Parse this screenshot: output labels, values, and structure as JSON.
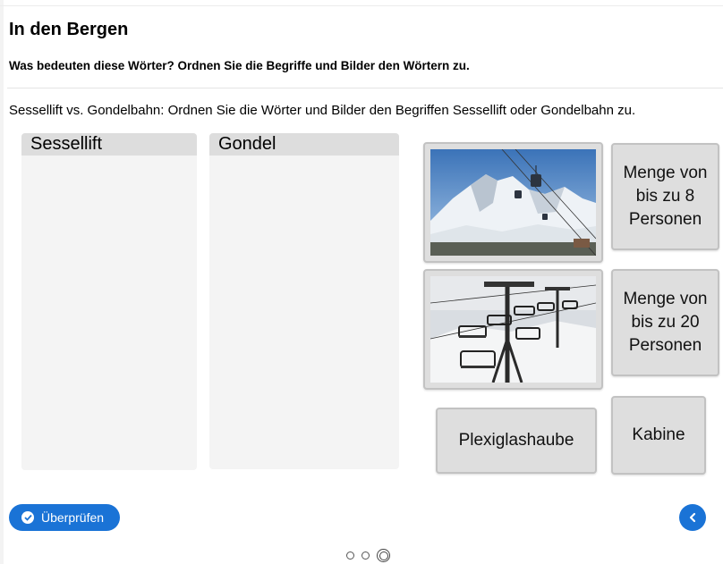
{
  "header": {
    "title": "In den Bergen",
    "subtitle": "Was bedeuten diese Wörter? Ordnen Sie die Begriffe und Bilder den Wörtern zu."
  },
  "task": {
    "instruction": "Sessellift vs. Gondelbahn: Ordnen Sie die Wörter und Bilder den Begriffen Sessellift oder Gondelbahn zu."
  },
  "zones": [
    {
      "label": "Sessellift"
    },
    {
      "label": "Gondel"
    }
  ],
  "cards": {
    "t1": "Menge von bis zu 8 Personen",
    "t2": "Menge von bis zu 20 Personen",
    "t3": "Plexiglashaube",
    "t4": "Kabine"
  },
  "footer": {
    "check_label": "Überprüfen",
    "pages": 3,
    "current_page": 3
  },
  "colors": {
    "accent": "#1a73d6",
    "card_bg": "#dedede",
    "zone_bg": "#f4f4f4",
    "zone_header": "#dddddd"
  }
}
